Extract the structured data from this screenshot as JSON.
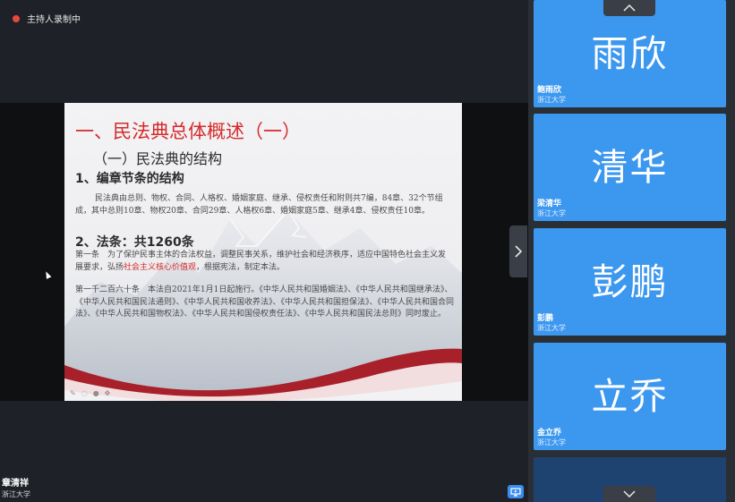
{
  "recording": {
    "label": "主持人录制中",
    "color": "#e8483d"
  },
  "slide": {
    "title": "一、民法典总体概述（一）",
    "heading1": "（一）民法典的结构",
    "heading2": "1、编章节条的结构",
    "para1": "民法典由总则、物权、合同、人格权、婚姻家庭、继承、侵权责任和附则共7编，84章、32个节组成，其中总则10章、物权20章、合同29章、人格权6章、婚姻家庭5章、继承4章、侵权责任10章。",
    "heading3": "2、法条：共1260条",
    "para2_a": "第一条　为了保护民事主体的合法权益，调整民事关系，维护社会和经济秩序，适应中国特色社会主义发展要求，弘扬",
    "para2_hl": "社会主义核心价值观",
    "para2_b": "，根据宪法，制定本法。",
    "para3": "第一千二百六十条　本法自2021年1月1日起施行。《中华人民共和国婚姻法》、《中华人民共和国继承法》、《中华人民共和国民法通则》、《中华人民共和国收养法》、《中华人民共和国担保法》、《中华人民共和国合同法》、《中华人民共和国物权法》、《中华人民共和国侵权责任法》、《中华人民共和国民法总则》同时废止。",
    "title_color": "#d62a2a",
    "highlight_color": "#d62a2a"
  },
  "presenter": {
    "name": "章清祥",
    "org": "浙江大学"
  },
  "participants": [
    {
      "avatar_text": "雨欣",
      "name": "鲍雨欣",
      "org": "浙江大学"
    },
    {
      "avatar_text": "清华",
      "name": "梁清华",
      "org": "浙江大学"
    },
    {
      "avatar_text": "彭鹏",
      "name": "彭鹏",
      "org": "浙江大学"
    },
    {
      "avatar_text": "立乔",
      "name": "金立乔",
      "org": "浙江大学"
    }
  ],
  "tile_color": "#3c97ef",
  "icons": {
    "scroll_up": "chevron-up-icon",
    "scroll_down": "chevron-down-icon",
    "expand": "chevron-right-icon",
    "screen_share": "screen-share-icon"
  }
}
